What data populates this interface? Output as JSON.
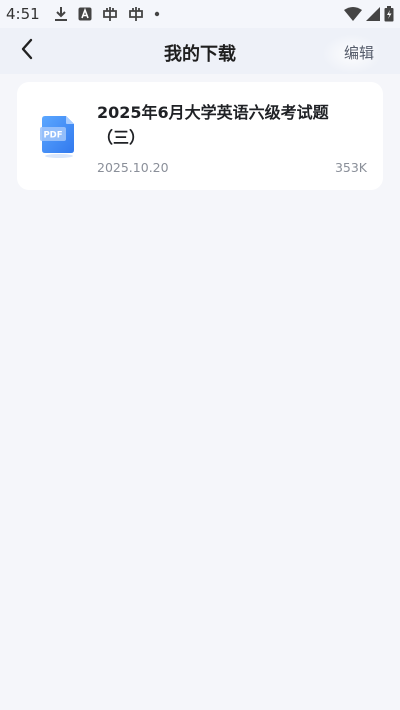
{
  "status_bar": {
    "time": "4:51",
    "icons_left": [
      "download-icon",
      "a-icon",
      "bug-icon",
      "bug-icon",
      "dot-icon"
    ],
    "icons_right": [
      "wifi-icon",
      "signal-icon",
      "battery-icon"
    ]
  },
  "nav": {
    "back_icon": "chevron-left-icon",
    "title": "我的下载",
    "edit_label": "编辑"
  },
  "downloads": [
    {
      "icon": "pdf-icon",
      "icon_label": "PDF",
      "title": "2025年6月大学英语六级考试题（三）",
      "date": "2025.10.20",
      "size": "353K"
    }
  ],
  "colors": {
    "background": "#f5f6fa",
    "card": "#ffffff",
    "pdf_blue": "#3f8cf2",
    "meta_text": "#8a8f99"
  }
}
